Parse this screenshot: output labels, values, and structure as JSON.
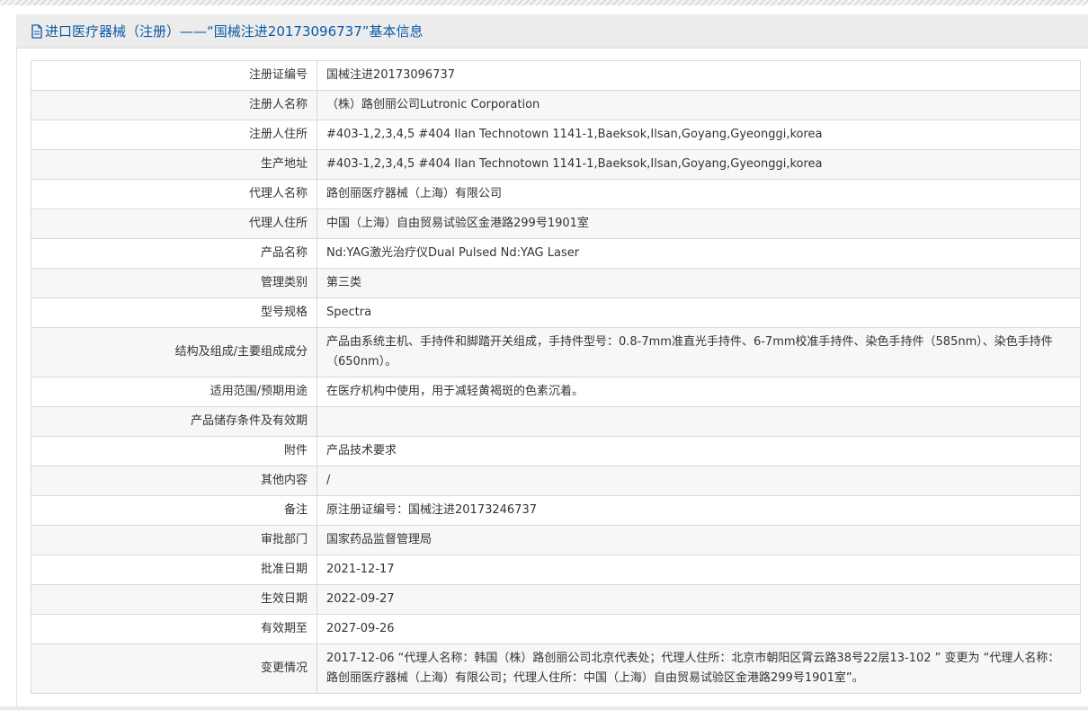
{
  "header": {
    "title": "进口医疗器械（注册）——“国械注进20173096737”基本信息",
    "icon": "document-icon"
  },
  "rows": [
    {
      "label": "注册证编号",
      "value": "国械注进20173096737"
    },
    {
      "label": "注册人名称",
      "value": "（株）路创丽公司Lutronic Corporation"
    },
    {
      "label": "注册人住所",
      "value": "#403-1,2,3,4,5 #404 Ilan Technotown 1141-1,Baeksok,Ilsan,Goyang,Gyeonggi,korea"
    },
    {
      "label": "生产地址",
      "value": "#403-1,2,3,4,5 #404 Ilan Technotown 1141-1,Baeksok,Ilsan,Goyang,Gyeonggi,korea"
    },
    {
      "label": "代理人名称",
      "value": "路创丽医疗器械（上海）有限公司"
    },
    {
      "label": "代理人住所",
      "value": "中国（上海）自由贸易试验区金港路299号1901室"
    },
    {
      "label": "产品名称",
      "value": "Nd:YAG激光治疗仪Dual Pulsed Nd:YAG Laser"
    },
    {
      "label": "管理类别",
      "value": "第三类"
    },
    {
      "label": "型号规格",
      "value": "Spectra"
    },
    {
      "label": "结构及组成/主要组成成分",
      "value": "产品由系统主机、手持件和脚踏开关组成，手持件型号：0.8-7mm准直光手持件、6-7mm校准手持件、染色手持件（585nm）、染色手持件（650nm）。"
    },
    {
      "label": "适用范围/预期用途",
      "value": "在医疗机构中使用，用于减轻黄褐斑的色素沉着。"
    },
    {
      "label": "产品储存条件及有效期",
      "value": ""
    },
    {
      "label": "附件",
      "value": "产品技术要求"
    },
    {
      "label": "其他内容",
      "value": "/"
    },
    {
      "label": "备注",
      "value": "原注册证编号：国械注进20173246737"
    },
    {
      "label": "审批部门",
      "value": "国家药品监督管理局"
    },
    {
      "label": "批准日期",
      "value": "2021-12-17"
    },
    {
      "label": "生效日期",
      "value": "2022-09-27"
    },
    {
      "label": "有效期至",
      "value": "2027-09-26"
    },
    {
      "label": "变更情况",
      "value": "2017-12-06 “代理人名称：韩国（株）路创丽公司北京代表处；代理人住所：北京市朝阳区霄云路38号22层13-102 ” 变更为 “代理人名称：路创丽医疗器械（上海）有限公司；代理人住所：中国（上海）自由贸易试验区金港路299号1901室”。"
    }
  ],
  "colors": {
    "title_text": "#0b5aa8",
    "title_bg": "#ececec",
    "border": "#d9d9d9",
    "row_alt": "#f7f7f7"
  }
}
